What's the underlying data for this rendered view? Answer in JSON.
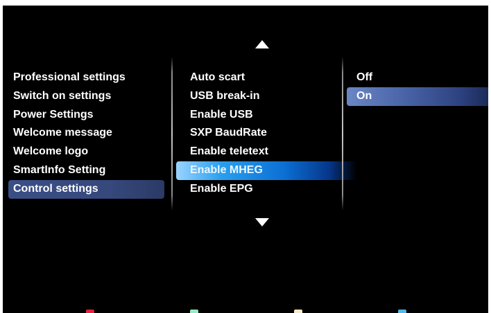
{
  "menu": {
    "left": [
      {
        "label": "Professional settings"
      },
      {
        "label": "Switch on settings"
      },
      {
        "label": "Power Settings"
      },
      {
        "label": "Welcome message"
      },
      {
        "label": "Welcome logo"
      },
      {
        "label": "SmartInfo Setting"
      },
      {
        "label": "Control settings",
        "selected": true
      }
    ],
    "middle": [
      {
        "label": "Auto scart"
      },
      {
        "label": "USB break-in"
      },
      {
        "label": "Enable USB"
      },
      {
        "label": "SXP BaudRate"
      },
      {
        "label": "Enable teletext"
      },
      {
        "label": "Enable MHEG",
        "focused": true
      },
      {
        "label": "Enable EPG"
      }
    ],
    "right": [
      {
        "label": "Off"
      },
      {
        "label": "On",
        "focused": true
      }
    ]
  },
  "icons": {
    "scroll_up": "triangle-up-icon",
    "scroll_down": "triangle-down-icon"
  },
  "colors": {
    "background": "#000000",
    "text": "#ffffff",
    "selected_bar": "#3a4f86",
    "focus_bar": "#0b6fd4",
    "key_red": "#e0243a",
    "key_green": "#9ce8c4",
    "key_yellow": "#f6eac0",
    "key_blue": "#4fb8e8"
  }
}
